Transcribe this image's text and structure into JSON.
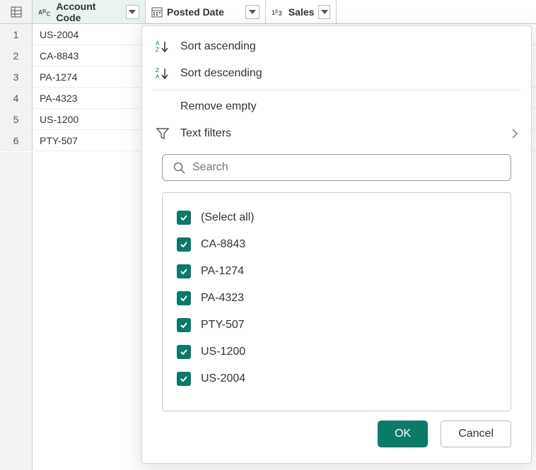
{
  "columns": {
    "account": "Account Code",
    "posted": "Posted Date",
    "sales": "Sales"
  },
  "rows": [
    {
      "n": "1",
      "account": "US-2004"
    },
    {
      "n": "2",
      "account": "CA-8843"
    },
    {
      "n": "3",
      "account": "PA-1274"
    },
    {
      "n": "4",
      "account": "PA-4323"
    },
    {
      "n": "5",
      "account": "US-1200"
    },
    {
      "n": "6",
      "account": "PTY-507"
    }
  ],
  "menu": {
    "sort_asc": "Sort ascending",
    "sort_desc": "Sort descending",
    "remove_empty": "Remove empty",
    "text_filters": "Text filters"
  },
  "search": {
    "placeholder": "Search"
  },
  "filter_values": [
    "(Select all)",
    "CA-8843",
    "PA-1274",
    "PA-4323",
    "PTY-507",
    "US-1200",
    "US-2004"
  ],
  "buttons": {
    "ok": "OK",
    "cancel": "Cancel"
  }
}
